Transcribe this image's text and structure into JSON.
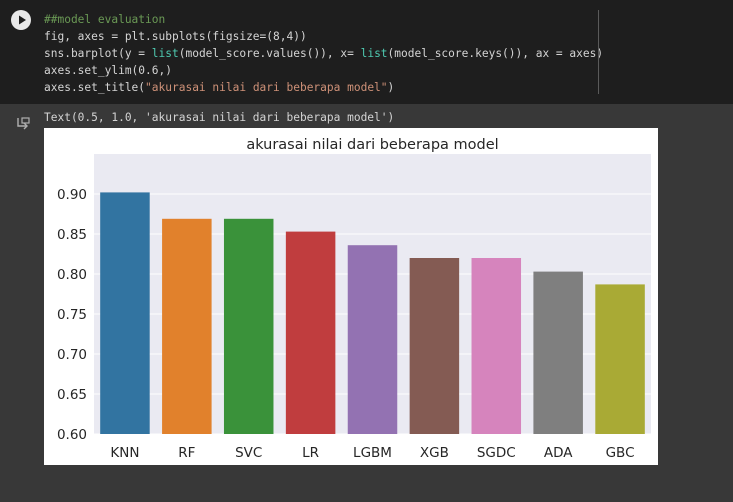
{
  "code_cell": {
    "lines": [
      {
        "type": "comment",
        "text": "##model evaluation"
      },
      {
        "type": "plain",
        "text": "fig, axes = plt.subplots(figsize=(8,4))"
      },
      {
        "type": "mixed",
        "parts": [
          {
            "t": "sns.barplot(y = ",
            "c": ""
          },
          {
            "t": "list",
            "c": "bi"
          },
          {
            "t": "(model_score.values()), x= ",
            "c": ""
          },
          {
            "t": "list",
            "c": "bi"
          },
          {
            "t": "(model_score.keys()), ax = axes)",
            "c": ""
          }
        ]
      },
      {
        "type": "plain",
        "text": "axes.set_ylim(0.6,)"
      },
      {
        "type": "mixed",
        "parts": [
          {
            "t": "axes.set_title(",
            "c": ""
          },
          {
            "t": "\"akurasai nilai dari beberapa model\"",
            "c": "st"
          },
          {
            "t": ")",
            "c": ""
          }
        ]
      }
    ]
  },
  "output": {
    "text": "Text(0.5, 1.0, 'akurasai nilai dari beberapa model')"
  },
  "chart_data": {
    "type": "bar",
    "title": "akurasai nilai dari beberapa model",
    "categories": [
      "KNN",
      "RF",
      "SVC",
      "LR",
      "LGBM",
      "XGB",
      "SGDC",
      "ADA",
      "GBC"
    ],
    "values": [
      0.902,
      0.869,
      0.869,
      0.853,
      0.836,
      0.82,
      0.82,
      0.803,
      0.787
    ],
    "colors": [
      "#3274a1",
      "#e1812c",
      "#3a923a",
      "#c03d3e",
      "#9372b2",
      "#845b53",
      "#d684bd",
      "#7f7f7f",
      "#a9aa35"
    ],
    "ylim": [
      0.6,
      0.95
    ],
    "yticks": [
      "0.60",
      "0.65",
      "0.70",
      "0.75",
      "0.80",
      "0.85",
      "0.90"
    ],
    "grid": true,
    "background": "#eaeaf2"
  }
}
